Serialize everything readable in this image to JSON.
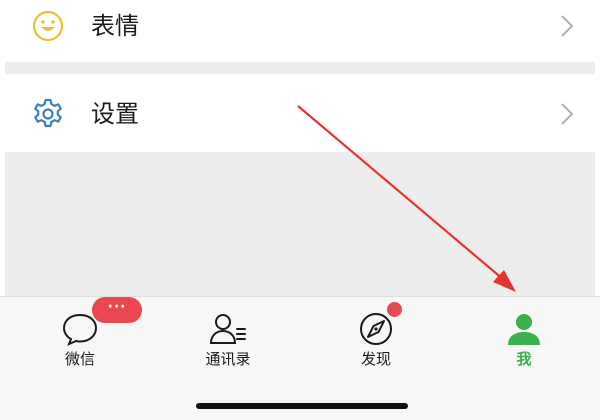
{
  "menu": {
    "stickers": {
      "label": "表情",
      "icon": "smiley-face-icon"
    },
    "settings": {
      "label": "设置",
      "icon": "gear-icon"
    }
  },
  "tabbar": {
    "tabs": [
      {
        "label": "微信",
        "icon": "chat-bubble-icon"
      },
      {
        "label": "通讯录",
        "icon": "contacts-icon"
      },
      {
        "label": "发现",
        "icon": "compass-icon"
      },
      {
        "label": "我",
        "icon": "person-icon",
        "active": true
      }
    ],
    "chats_badge": "···"
  },
  "colors": {
    "active_tab": "#3cb04d",
    "badge": "#e8484e",
    "annotation_arrow": "#e8322f",
    "smiley": "#e9c13a",
    "gear": "#3b82c4"
  }
}
